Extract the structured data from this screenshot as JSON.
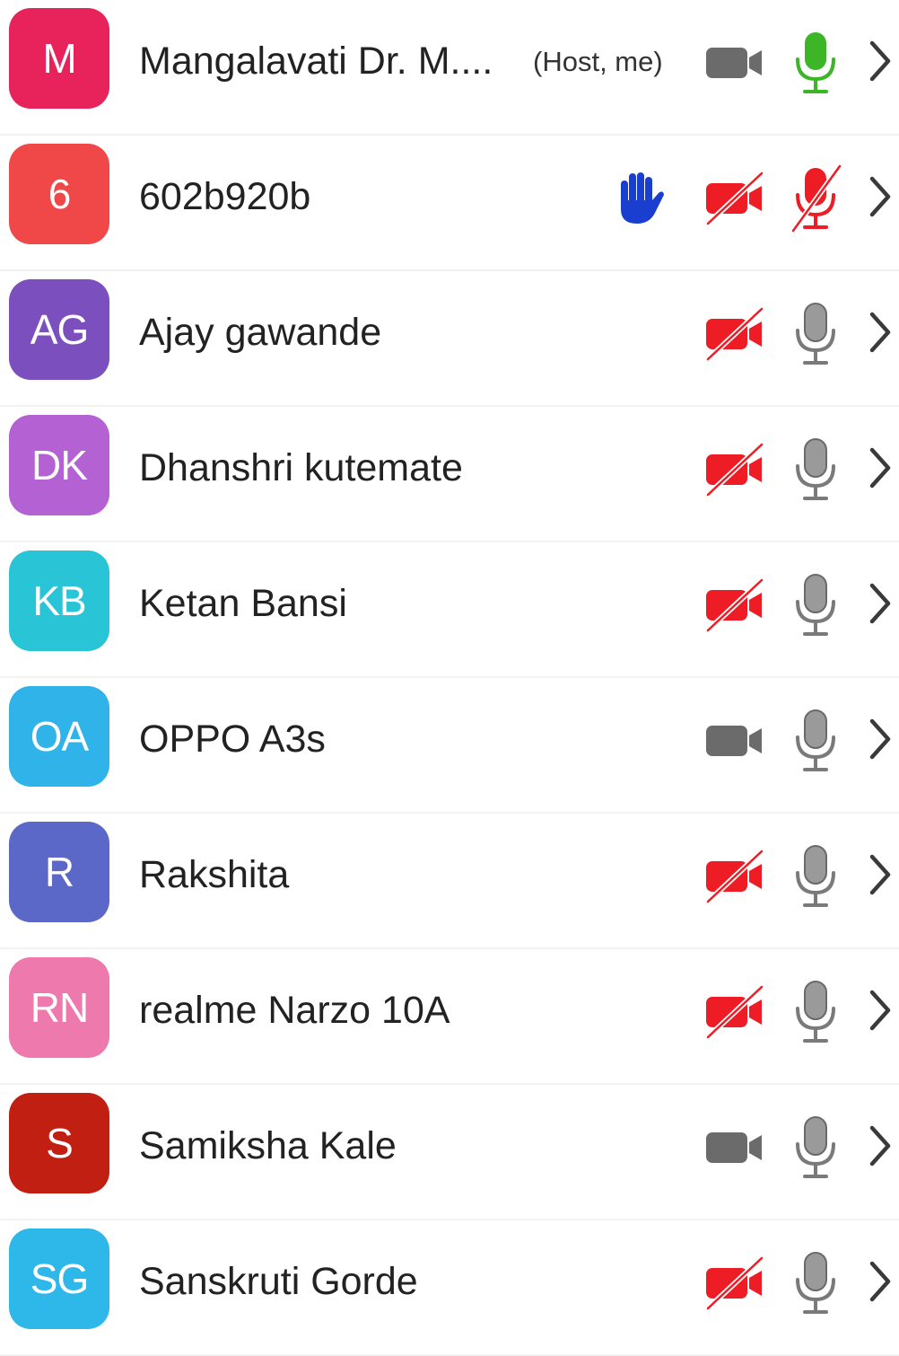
{
  "participants": [
    {
      "initials": "M",
      "name": "Mangalavati Dr. M....",
      "tag": "(Host, me)",
      "avatar_color": "#e8225a",
      "hand_raised": false,
      "video": "on",
      "audio": "unmuted"
    },
    {
      "initials": "6",
      "name": "602b920b",
      "tag": "",
      "avatar_color": "#f04848",
      "hand_raised": true,
      "video": "off",
      "audio": "muted"
    },
    {
      "initials": "AG",
      "name": "Ajay gawande",
      "tag": "",
      "avatar_color": "#7b4fbd",
      "hand_raised": false,
      "video": "off",
      "audio": "available"
    },
    {
      "initials": "DK",
      "name": "Dhanshri kutemate",
      "tag": "",
      "avatar_color": "#b361d3",
      "hand_raised": false,
      "video": "off",
      "audio": "available"
    },
    {
      "initials": "KB",
      "name": "Ketan Bansi",
      "tag": "",
      "avatar_color": "#29c4d6",
      "hand_raised": false,
      "video": "off",
      "audio": "available"
    },
    {
      "initials": "OA",
      "name": "OPPO A3s",
      "tag": "",
      "avatar_color": "#2fb3e8",
      "hand_raised": false,
      "video": "on",
      "audio": "available"
    },
    {
      "initials": "R",
      "name": "Rakshita",
      "tag": "",
      "avatar_color": "#5c68c7",
      "hand_raised": false,
      "video": "off",
      "audio": "available"
    },
    {
      "initials": "RN",
      "name": "realme Narzo 10A",
      "tag": "",
      "avatar_color": "#ee79ad",
      "hand_raised": false,
      "video": "off",
      "audio": "available"
    },
    {
      "initials": "S",
      "name": "Samiksha Kale",
      "tag": "",
      "avatar_color": "#c01f12",
      "hand_raised": false,
      "video": "on",
      "audio": "available"
    },
    {
      "initials": "SG",
      "name": "Sanskruti Gorde",
      "tag": "",
      "avatar_color": "#2eb8ea",
      "hand_raised": false,
      "video": "off",
      "audio": "available"
    }
  ],
  "colors": {
    "camera_on": "#6b6b6b",
    "camera_off": "#ee1c24",
    "mic_unmuted": "#3cb527",
    "mic_muted": "#ee1c24",
    "mic_available": "#7a7a7a",
    "raised_hand": "#1a3fd0",
    "chevron": "#3a3a3a"
  },
  "icons": {
    "hand": "raised-hand-icon",
    "camera": "video-camera-icon",
    "mic": "microphone-icon",
    "chevron": "chevron-right-icon"
  }
}
